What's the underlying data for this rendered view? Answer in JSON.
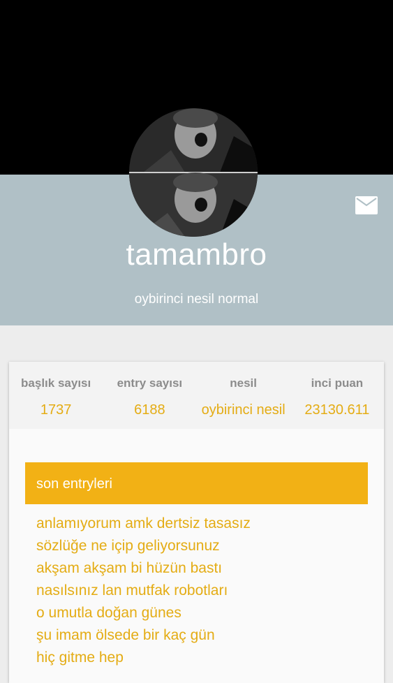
{
  "profile": {
    "username": "tamambro",
    "rank": "oybirinci nesil normal",
    "avatar_icon": "avatar-photo",
    "message_icon": "envelope-icon"
  },
  "stats": [
    {
      "label": "başlık sayısı",
      "value": "1737"
    },
    {
      "label": "entry sayısı",
      "value": "6188"
    },
    {
      "label": "nesil",
      "value": "oybirinci nesil"
    },
    {
      "label": "inci puan",
      "value": "23130.611"
    }
  ],
  "entries": {
    "header": "son entryleri",
    "items": [
      "anlamıyorum amk dertsiz tasasız",
      "sözlüğe ne içip geliyorsunuz",
      "akşam akşam bi hüzün bastı",
      "nasılsınız lan mutfak robotları",
      "o umutla doğan günes",
      "şu imam ölsede bir kaç gün",
      "hiç gitme hep"
    ]
  },
  "colors": {
    "cover": "#000000",
    "band": "#b0c0c6",
    "accent": "#f2b115",
    "accent_text": "#e4ac14"
  }
}
